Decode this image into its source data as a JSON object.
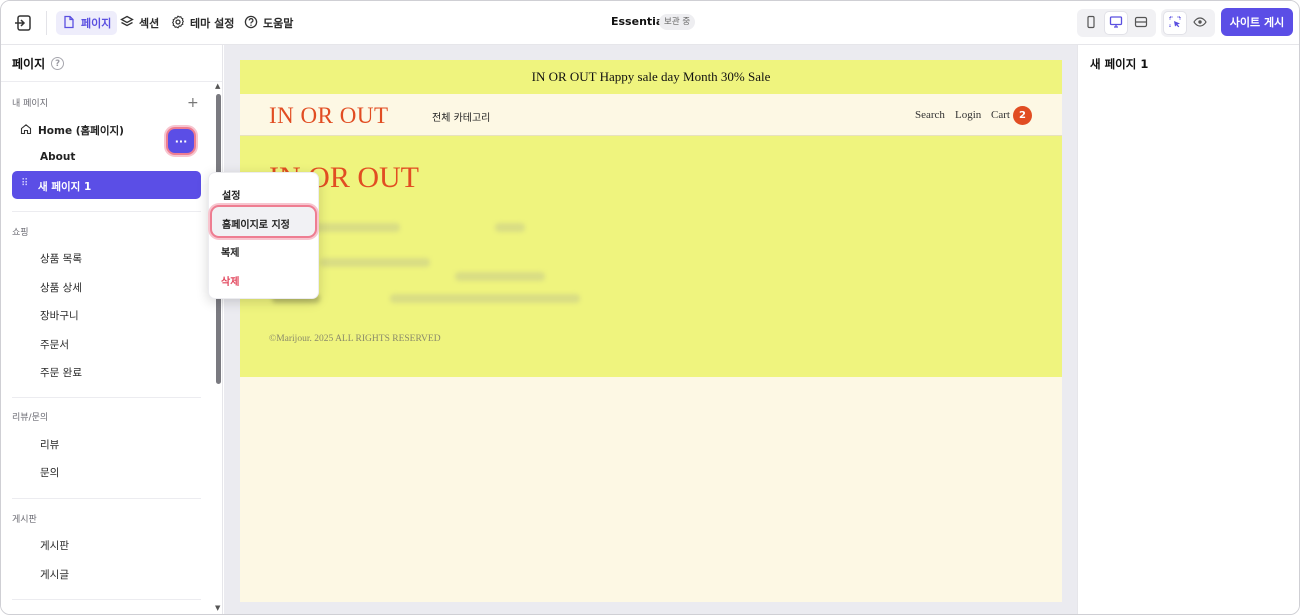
{
  "topbar": {
    "tabs": [
      {
        "label": "페이지",
        "icon": "page-icon",
        "active": true
      },
      {
        "label": "섹션",
        "icon": "layers-icon",
        "active": false
      },
      {
        "label": "테마 설정",
        "icon": "gear-icon",
        "active": false
      },
      {
        "label": "도움말",
        "icon": "question-icon",
        "active": false
      }
    ],
    "site_title": "Essential",
    "status_badge": "보관 중",
    "publish_label": "사이트 게시"
  },
  "sidebar": {
    "title": "페이지",
    "my_pages_label": "내 페이지",
    "home_label": "Home (홈페이지)",
    "about_label": "About",
    "selected_label": "새 페이지 1",
    "more_label": "···",
    "shopping_label": "쇼핑",
    "shopping_items": [
      "상품 목록",
      "상품 상세",
      "장바구니",
      "주문서",
      "주문 완료"
    ],
    "review_label": "리뷰/문의",
    "review_items": [
      "리뷰",
      "문의"
    ],
    "board_label": "게시판",
    "board_items": [
      "게시판",
      "게시글"
    ]
  },
  "context_menu": {
    "settings": "설정",
    "set_home": "홈페이지로 지정",
    "duplicate": "복제",
    "delete": "삭제"
  },
  "preview": {
    "banner": "IN OR OUT Happy sale day Month 30% Sale",
    "logo": "IN OR OUT",
    "category": "전체 카테고리",
    "search": "Search",
    "login": "Login",
    "cart": "Cart",
    "cart_count": "2",
    "footer_logo": "IN OR OUT",
    "copyright": "©Marijour. 2025 ALL RIGHTS RESERVED"
  },
  "right_panel": {
    "title": "새 페이지 1"
  },
  "colors": {
    "accent": "#5b4ee6",
    "highlight_ring": "#ee7d91",
    "brand_orange": "#e14d22",
    "banner_yellow": "#eff47e",
    "cream": "#fdf8e4",
    "danger": "#e2455c"
  }
}
